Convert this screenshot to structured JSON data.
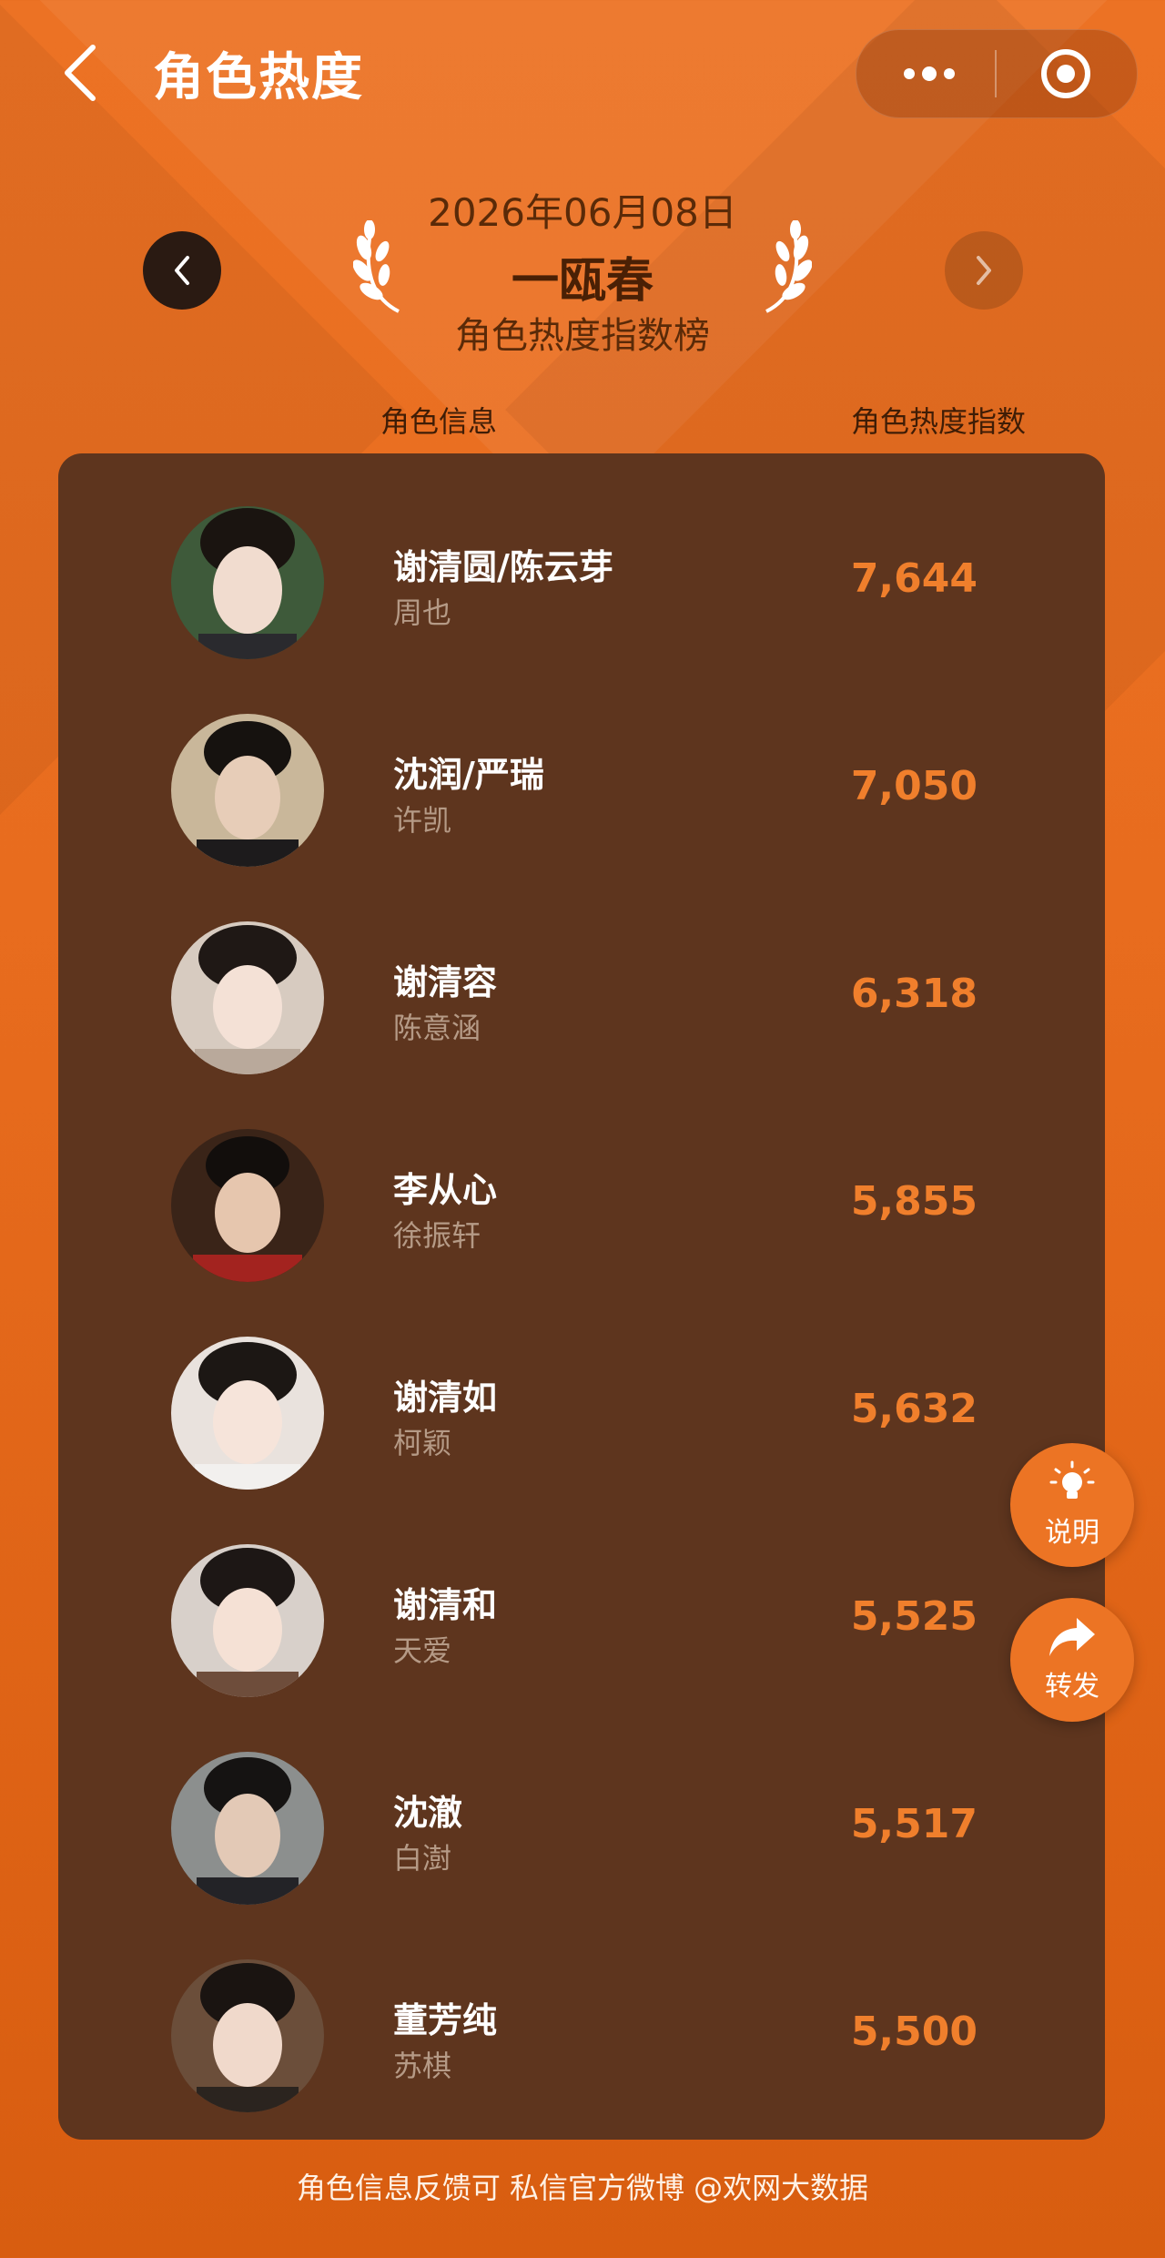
{
  "topbar": {
    "title": "角色热度",
    "back_icon": "chevron-left-icon",
    "more_icon": "more-dots-icon",
    "close_icon": "target-close-icon"
  },
  "header": {
    "date": "2026年06月08日",
    "drama": "一瓯春",
    "board": "角色热度指数榜",
    "prev_icon": "chevron-left-icon",
    "next_icon": "chevron-right-icon"
  },
  "columns": {
    "info": "角色信息",
    "index": "角色热度指数"
  },
  "rows": [
    {
      "role": "谢清圆/陈云芽",
      "actor": "周也",
      "score": "7,644"
    },
    {
      "role": "沈润/严瑞",
      "actor": "许凯",
      "score": "7,050"
    },
    {
      "role": "谢清容",
      "actor": "陈意涵",
      "score": "6,318"
    },
    {
      "role": "李从心",
      "actor": "徐振轩",
      "score": "5,855"
    },
    {
      "role": "谢清如",
      "actor": "柯颖",
      "score": "5,632"
    },
    {
      "role": "谢清和",
      "actor": "天爱",
      "score": "5,525"
    },
    {
      "role": "沈澈",
      "actor": "白澍",
      "score": "5,517"
    },
    {
      "role": "董芳纯",
      "actor": "苏棋",
      "score": "5,500"
    }
  ],
  "float_buttons": {
    "explain": "说明",
    "share": "转发"
  },
  "footer": "角色信息反馈可 私信官方微博 @欢网大数据",
  "colors": {
    "background": "#ec7224",
    "panel": "#5e351e",
    "score": "#f07f2c",
    "actor": "#b59a86"
  }
}
